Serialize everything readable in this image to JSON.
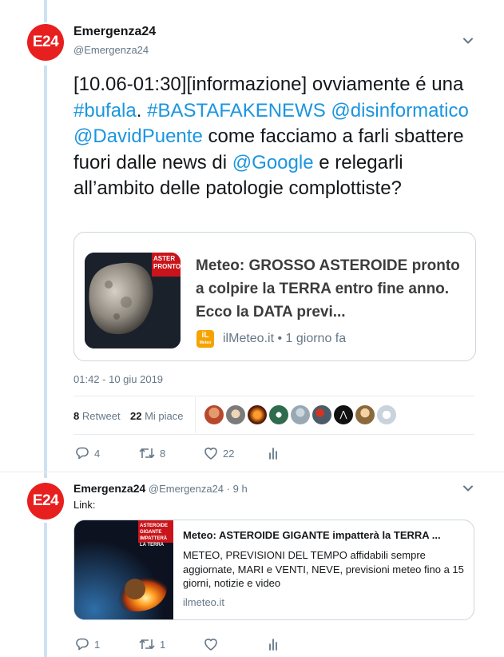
{
  "tweet": {
    "avatar_text": "E24",
    "name": "Emergenza24",
    "handle": "@Emergenza24",
    "text_parts": [
      "[10.06-01:30][informazione] ovviamente é una ",
      "#bufala",
      ". ",
      "#BASTAFAKENEWS",
      " ",
      "@disinformatico",
      " ",
      "@DavidPuente",
      " come facciamo a farli sbattere fuori dalle news di ",
      "@Google",
      " e relegarli all’ambito delle patologie complottiste?"
    ],
    "card": {
      "title": "Meteo: GROSSO ASTEROIDE pronto a colpire la TERRA entro fine anno. Ecco la DATA previ...",
      "image_caption": "ASTER PRONTO",
      "source_icon": "iL",
      "source_icon_sub": "Meteo",
      "source": "ilMeteo.it",
      "age": " • 1 giorno fa"
    },
    "timestamp": "01:42 - 10 giu 2019",
    "retweets_count": "8",
    "retweets_label": "Retweet",
    "likes_count": "22",
    "likes_label": "Mi piace",
    "actions": {
      "reply": "4",
      "retweet": "8",
      "like": "22"
    }
  },
  "reply": {
    "avatar_text": "E24",
    "name": "Emergenza24",
    "handle": "@Emergenza24",
    "time": " · 9 h",
    "text": "Link:",
    "card": {
      "title": "Meteo: ASTEROIDE GIGANTE impatterà la TERRA ...",
      "description": "METEO, PREVISIONI DEL TEMPO affidabili sempre aggiornate, MARI e VENTI, NEVE, previsioni meteo fino a 15 giorni, notizie e video",
      "image_caption": "ASTEROIDE GIGANTE IMPATTERÀ LA TERRA",
      "domain": "ilmeteo.it"
    },
    "actions": {
      "reply": "1",
      "retweet": "1"
    }
  },
  "colors": {
    "brand_red": "#e81f1f",
    "link_blue": "#1b95e0",
    "muted": "#657786",
    "thread_line": "#cce2f2"
  }
}
